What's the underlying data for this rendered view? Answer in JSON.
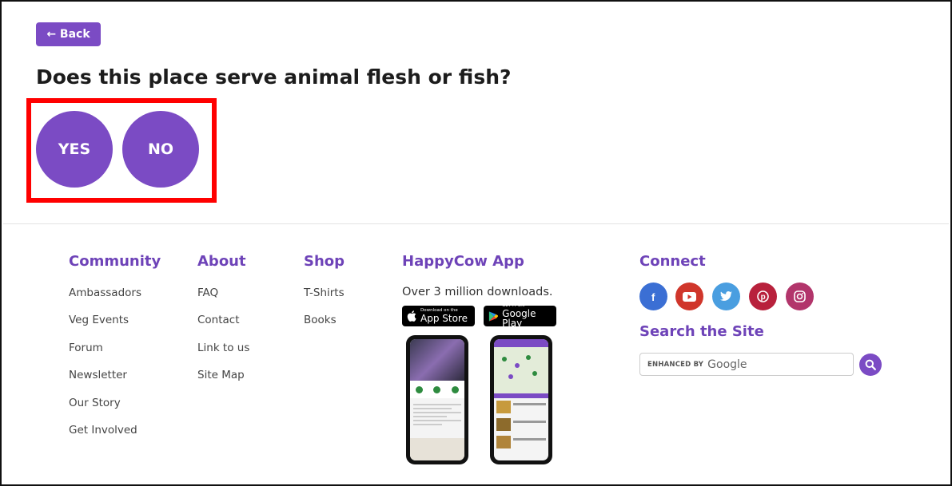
{
  "question": {
    "back_label": "← Back",
    "title": "Does this place serve animal flesh or fish?",
    "yes_label": "YES",
    "no_label": "NO"
  },
  "footer": {
    "community": {
      "heading": "Community",
      "links": [
        "Ambassadors",
        "Veg Events",
        "Forum",
        "Newsletter",
        "Our Story",
        "Get Involved"
      ]
    },
    "about": {
      "heading": "About",
      "links": [
        "FAQ",
        "Contact",
        "Link to us",
        "Site Map"
      ]
    },
    "shop": {
      "heading": "Shop",
      "links": [
        "T-Shirts",
        "Books"
      ]
    },
    "app": {
      "heading": "HappyCow App",
      "subtitle": "Over 3 million downloads.",
      "app_store_small": "Download on the",
      "app_store_big": "App Store",
      "google_play_small": "GET IT ON",
      "google_play_big": "Google Play"
    },
    "connect": {
      "heading": "Connect",
      "social": [
        {
          "icon": "facebook-icon",
          "color": "#3b6fd4"
        },
        {
          "icon": "youtube-icon",
          "color": "#d0362b"
        },
        {
          "icon": "twitter-icon",
          "color": "#4a9ee0"
        },
        {
          "icon": "pinterest-icon",
          "color": "#b8213c"
        },
        {
          "icon": "instagram-icon",
          "color": "#b2356b"
        }
      ]
    },
    "search": {
      "heading": "Search the Site",
      "enhanced_by": "ENHANCED BY",
      "provider": "Google"
    }
  },
  "colors": {
    "accent": "#7b4bc4",
    "heading": "#6e43b8",
    "highlight": "#ff0000"
  }
}
